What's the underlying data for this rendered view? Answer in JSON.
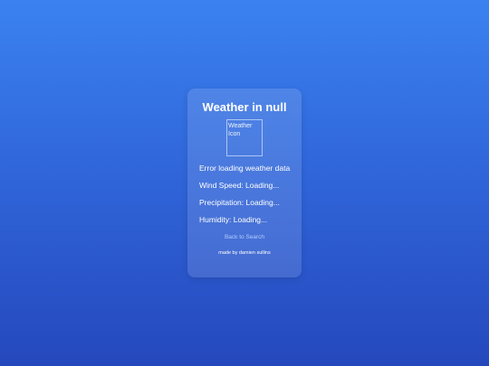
{
  "card": {
    "title": "Weather in null",
    "icon_alt": "Weather Icon",
    "status": "Error loading weather data",
    "wind": "Wind Speed: Loading...",
    "precipitation": "Precipitation: Loading...",
    "humidity": "Humidity: Loading...",
    "back_link": "Back to Search",
    "credit": "made by damien sullins"
  },
  "colors": {
    "background_top": "#3b82f0",
    "background_bottom": "#2548bd",
    "link": "#b3ccff",
    "text": "#ffffff"
  }
}
